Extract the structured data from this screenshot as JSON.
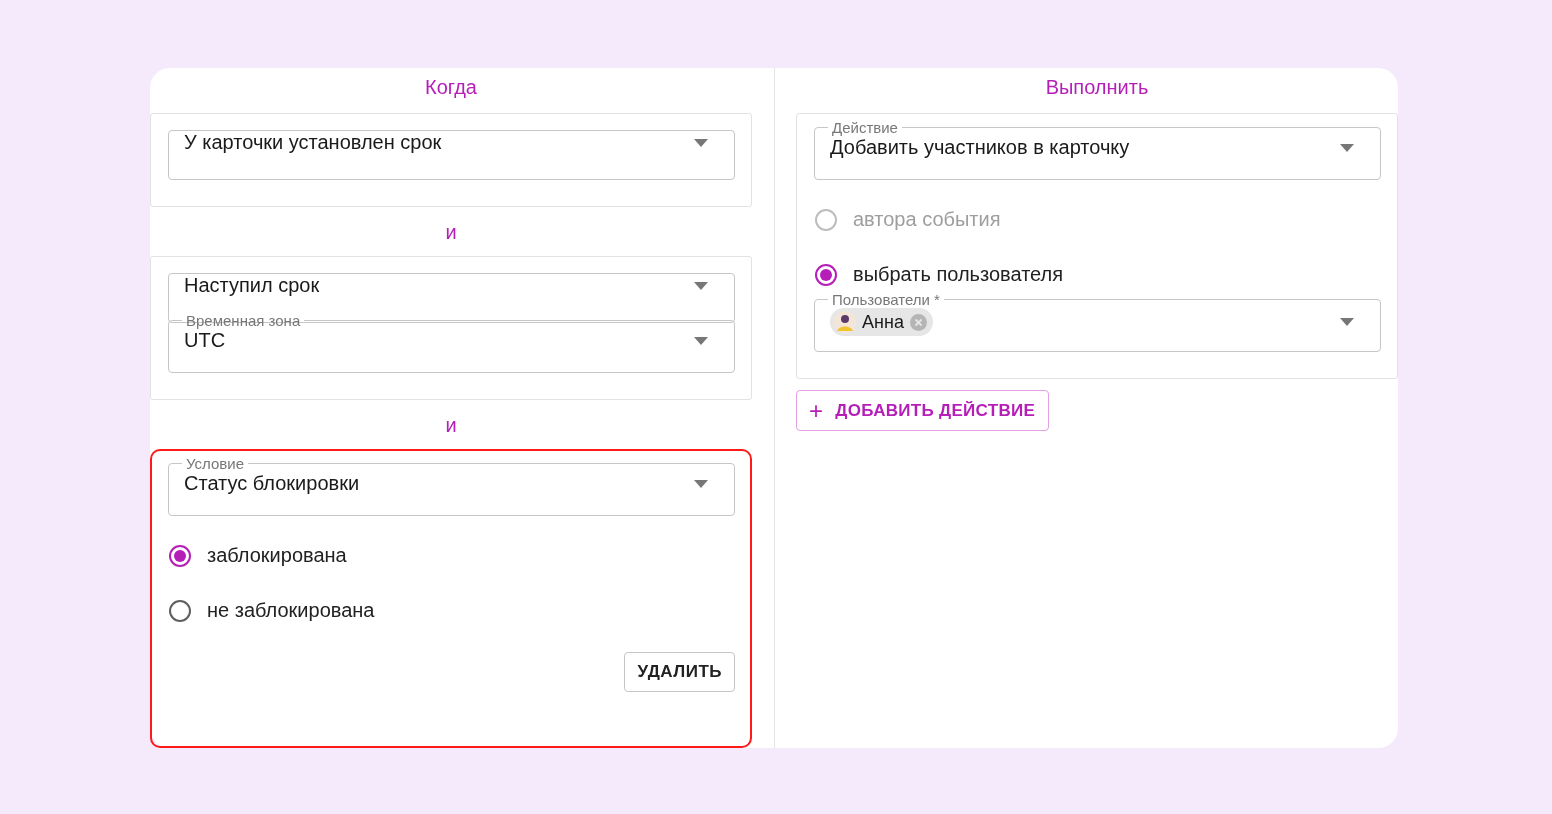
{
  "when_panel": {
    "title": "Когда",
    "items": [
      {
        "kind": "block",
        "highlighted": false,
        "controls": [
          {
            "kind": "select",
            "value": "У карточки установлен срок"
          }
        ]
      },
      {
        "kind": "connector",
        "text": "и"
      },
      {
        "kind": "block",
        "highlighted": false,
        "controls": [
          {
            "kind": "select",
            "value": "Наступил срок"
          },
          {
            "kind": "select",
            "label": "Временная зона",
            "value": "UTC"
          }
        ]
      },
      {
        "kind": "connector",
        "text": "и"
      },
      {
        "kind": "block",
        "highlighted": true,
        "controls": [
          {
            "kind": "select",
            "label": "Условие",
            "value": "Статус блокировки"
          },
          {
            "kind": "radio",
            "label": "заблокирована",
            "selected": true,
            "disabled": false
          },
          {
            "kind": "radio",
            "label": "не заблокирована",
            "selected": false,
            "disabled": false
          },
          {
            "kind": "button",
            "label": "УДАЛИТЬ"
          }
        ]
      }
    ]
  },
  "do_panel": {
    "title": "Выполнить",
    "items": [
      {
        "kind": "block",
        "highlighted": false,
        "controls": [
          {
            "kind": "select",
            "label": "Действие",
            "value": "Добавить участников в карточку"
          },
          {
            "kind": "radio",
            "label": "автора события",
            "selected": false,
            "disabled": true
          },
          {
            "kind": "radio",
            "label": "выбрать пользователя",
            "selected": true,
            "disabled": false
          },
          {
            "kind": "chip_select",
            "label": "Пользователи *",
            "chips": [
              {
                "name": "Анна"
              }
            ]
          }
        ]
      },
      {
        "kind": "add_button",
        "icon": "+",
        "label": "ДОБАВИТЬ ДЕЙСТВИЕ"
      }
    ]
  }
}
